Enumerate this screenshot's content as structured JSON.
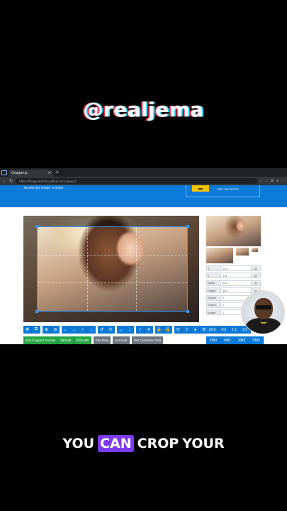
{
  "overlay": {
    "handle": "@realjema",
    "caption_words": [
      "YOU",
      "CAN",
      "CROP",
      "YOUR"
    ]
  },
  "browser": {
    "tab_title": "Cropper.js",
    "url": "https://fengyuanchen.github.io/cropperjs/"
  },
  "page": {
    "hero_subtitle": "JavaScript image cropper.",
    "carbon_text": "ads via Carbon"
  },
  "form": {
    "fields": [
      {
        "label": "X",
        "value": "233",
        "unit": "px"
      },
      {
        "label": "Y",
        "value": "131",
        "unit": "px"
      },
      {
        "label": "Width",
        "value": "640",
        "unit": "px"
      },
      {
        "label": "Height",
        "value": "360",
        "unit": "px"
      },
      {
        "label": "Rotate",
        "value": "0",
        "unit": "deg"
      },
      {
        "label": "ScaleX",
        "value": "1",
        "unit": ""
      },
      {
        "label": "ScaleY",
        "value": "1",
        "unit": ""
      }
    ]
  },
  "toolbar": {
    "groups": [
      [
        "move-icon",
        "crop-icon"
      ],
      [
        "zoom-in-icon",
        "zoom-out-icon"
      ],
      [
        "arrow-left-icon",
        "arrow-right-icon",
        "arrow-up-icon",
        "arrow-down-icon"
      ],
      [
        "rotate-left-icon",
        "rotate-right-icon"
      ],
      [
        "flip-h-icon",
        "flip-v-icon"
      ],
      [
        "check-icon",
        "close-icon"
      ],
      [
        "lock-icon",
        "unlock-icon"
      ],
      [
        "refresh-icon",
        "upload-icon"
      ],
      [
        "user-icon",
        "settings-icon"
      ]
    ],
    "glyphs": [
      "✥",
      "⧉",
      "⊕",
      "⊖",
      "←",
      "→",
      "↑",
      "↓",
      "↺",
      "↻",
      "↔",
      "↕",
      "✓",
      "✕",
      "🔒",
      "🔓",
      "⟳",
      "⇪",
      "●",
      "⚙"
    ]
  },
  "actions": {
    "cropped_canvas": "Get Cropped Canvas",
    "size_1": "160×90",
    "size_2": "320×180",
    "get_data": "Get Data",
    "set_data": "Set Data",
    "get_container_data": "Get Container Data"
  },
  "ratios": [
    "16:9",
    "4:3",
    "1:1",
    "2:3"
  ],
  "view_modes": [
    "VM0",
    "VM1",
    "VM2",
    "VM3"
  ]
}
